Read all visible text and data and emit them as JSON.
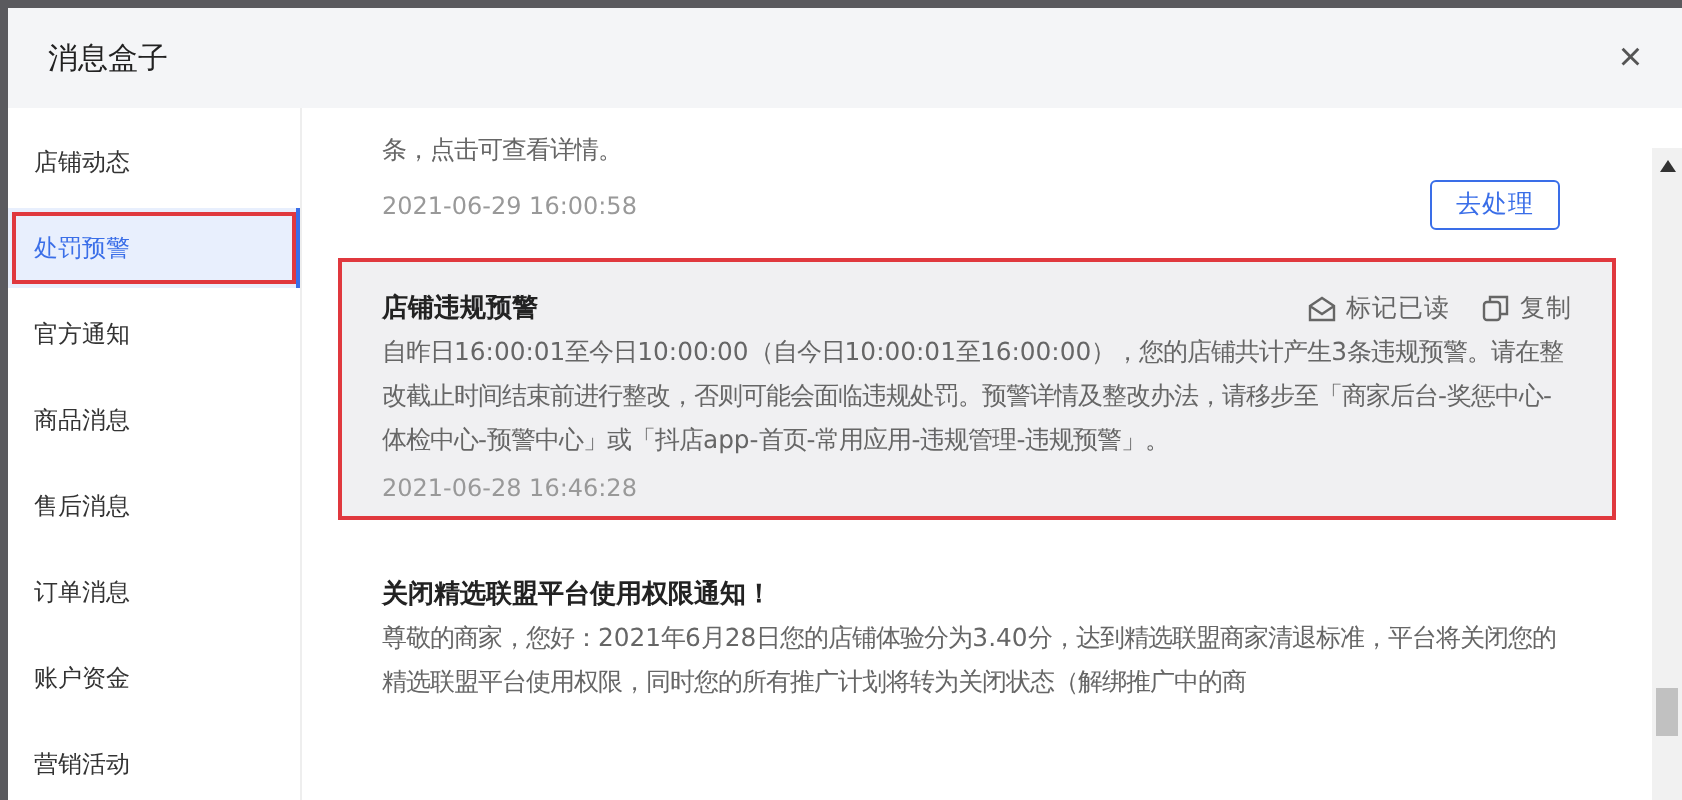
{
  "dialog": {
    "title": "消息盒子",
    "close": "×"
  },
  "sidebar": {
    "items": [
      {
        "label": "店铺动态",
        "selected": false,
        "highlighted": false
      },
      {
        "label": "处罚预警",
        "selected": true,
        "highlighted": true
      },
      {
        "label": "官方通知",
        "selected": false,
        "highlighted": false
      },
      {
        "label": "商品消息",
        "selected": false,
        "highlighted": false
      },
      {
        "label": "售后消息",
        "selected": false,
        "highlighted": false
      },
      {
        "label": "订单消息",
        "selected": false,
        "highlighted": false
      },
      {
        "label": "账户资金",
        "selected": false,
        "highlighted": false
      },
      {
        "label": "营销活动",
        "selected": false,
        "highlighted": false
      }
    ]
  },
  "messages": [
    {
      "kind": "plain",
      "body": "条，点击可查看详情。",
      "time": "2021-06-29 16:00:58",
      "button": "去处理",
      "highlighted": false
    },
    {
      "kind": "card",
      "title": "店铺违规预警",
      "actions": [
        {
          "kind": "mark-read",
          "label": "标记已读"
        },
        {
          "kind": "copy",
          "label": "复制"
        }
      ],
      "body": "自昨日16:00:01至今日10:00:00（自今日10:00:01至16:00:00），您的店铺共计产生3条违规预警。请在整改截止时间结束前进行整改，否则可能会面临违规处罚。预警详情及整改办法，请移步至「商家后台-奖惩中心-体检中心-预警中心」或「抖店app-首页-常用应用-违规管理-违规预警」。",
      "time": "2021-06-28 16:46:28",
      "highlighted": true
    },
    {
      "kind": "card",
      "title": "关闭精选联盟平台使用权限通知！",
      "body": "尊敬的商家，您好：2021年6月28日您的店铺体验分为3.40分，达到精选联盟商家清退标准，平台将关闭您的精选联盟平台使用权限，同时您的所有推广计划将转为关闭状态（解绑推广中的商",
      "highlighted": false
    }
  ]
}
